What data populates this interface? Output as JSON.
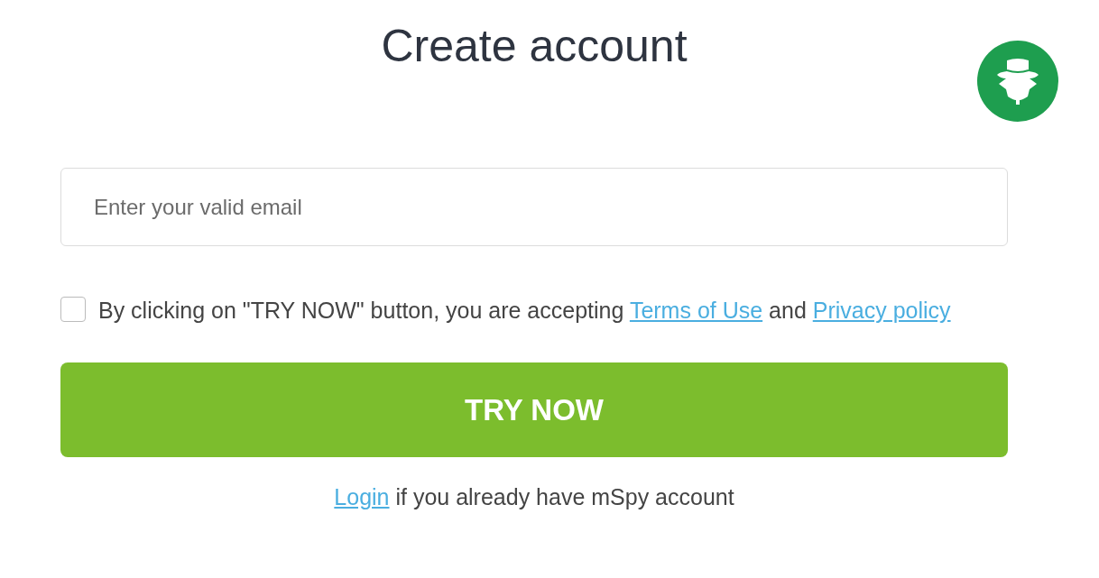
{
  "title": "Create account",
  "email_field": {
    "placeholder": "Enter your valid email"
  },
  "consent": {
    "checked": false,
    "parts": [
      {
        "kind": "text",
        "text": "By clicking on \"TRY NOW\" button, you are accepting "
      },
      {
        "kind": "link",
        "text": "Terms of Use"
      },
      {
        "kind": "text",
        "text": " and "
      },
      {
        "kind": "link",
        "text": "Privacy policy"
      }
    ]
  },
  "submit_button": {
    "label": "TRY NOW"
  },
  "login_line": {
    "parts": [
      {
        "kind": "link",
        "text": "Login"
      },
      {
        "kind": "text",
        "text": " if you already have mSpy account"
      }
    ]
  }
}
